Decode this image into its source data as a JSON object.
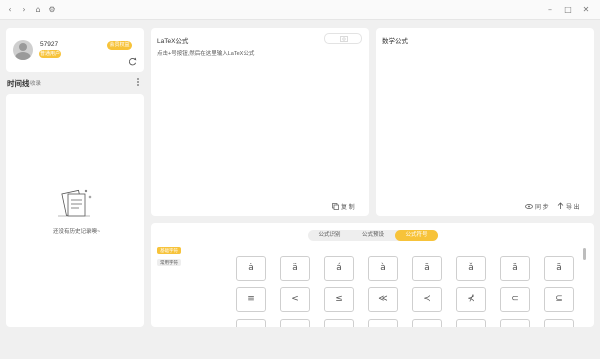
{
  "window": {
    "icons": [
      "chevron-left-icon",
      "chevron-right-icon",
      "home-icon",
      "settings-icon",
      "minimize-icon",
      "maximize-icon",
      "close-icon"
    ]
  },
  "user": {
    "name": "57927",
    "badge": "普通用户",
    "upgrade_button": "会员权益"
  },
  "history": {
    "title": "时间线",
    "subtitle": "收录",
    "empty_text": "还没有历史记录噢~"
  },
  "latex_panel": {
    "title": "LaTeX公式",
    "hint": "点击+号按钮,然后在这里输入LaTeX公式",
    "copy_label": "复 制"
  },
  "math_panel": {
    "title": "数学公式",
    "sync_label": "同 步",
    "export_label": "导 出"
  },
  "tabs": {
    "items": [
      "公式识别",
      "公式预设",
      "公式符号"
    ],
    "active": 2
  },
  "tags": {
    "items": [
      "基础字符",
      "常用字符"
    ],
    "active": 0
  },
  "symbols": {
    "row1": [
      "ȧ",
      "ä",
      "á",
      "à",
      "ā",
      "ǎ",
      "ă",
      "ã"
    ],
    "row2": [
      "≡",
      "<",
      "≤",
      "≪",
      "≺",
      "⊀",
      "⊂",
      "⊆"
    ]
  },
  "colors": {
    "accent": "#f7c33a",
    "background": "#f0f0f0",
    "panel": "#ffffff"
  }
}
